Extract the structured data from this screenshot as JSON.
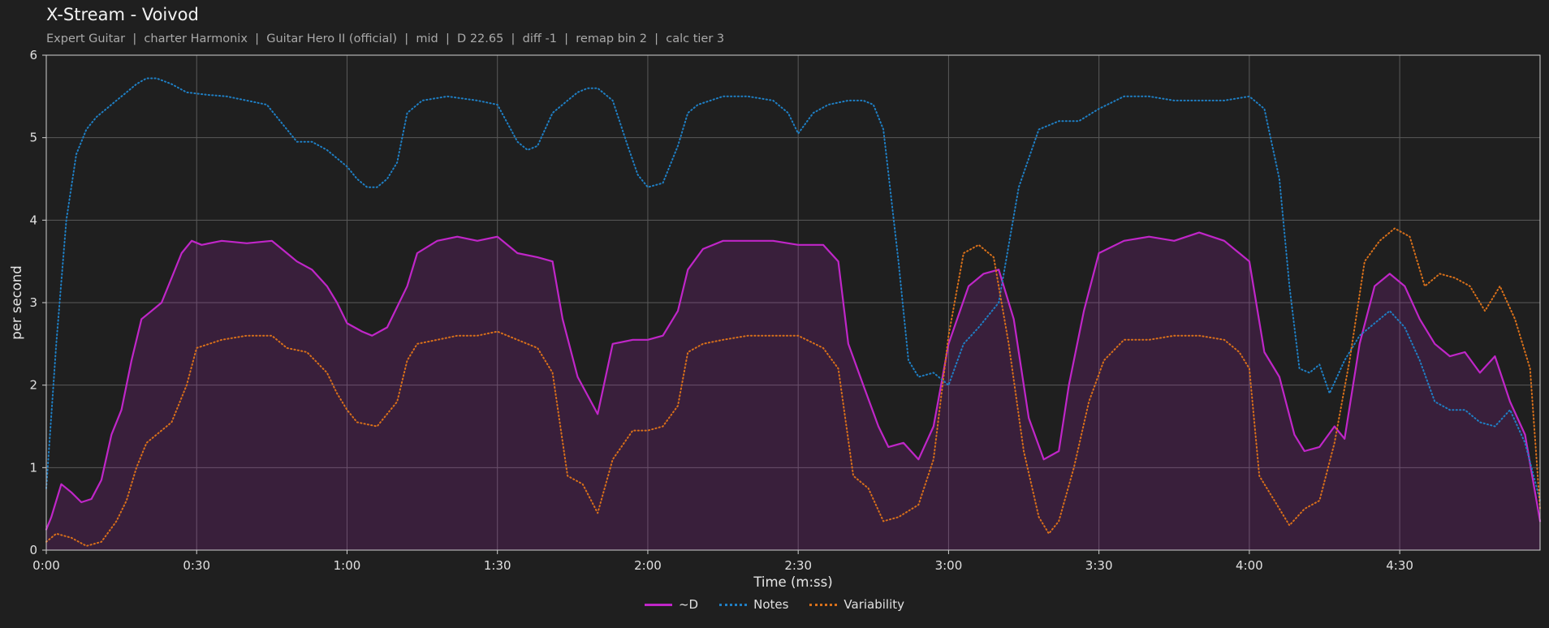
{
  "header": {
    "title": "X-Stream - Voivod",
    "subtitle": "Expert Guitar  |  charter Harmonix  |  Guitar Hero II (official)  |  mid  |  D 22.65  |  diff -1  |  remap bin 2  |  calc tier 3"
  },
  "chart_data": {
    "type": "line",
    "xlabel": "Time (m:ss)",
    "ylabel": "per second",
    "xlim": [
      0,
      298
    ],
    "ylim": [
      0,
      6
    ],
    "x_ticks": [
      0,
      30,
      60,
      90,
      120,
      150,
      180,
      210,
      240,
      270
    ],
    "x_tick_labels": [
      "0:00",
      "0:30",
      "1:00",
      "1:30",
      "2:00",
      "2:30",
      "3:00",
      "3:30",
      "4:00",
      "4:30"
    ],
    "y_ticks": [
      0,
      1,
      2,
      3,
      4,
      5,
      6
    ],
    "y_tick_labels": [
      "0",
      "1",
      "2",
      "3",
      "4",
      "5",
      "6"
    ],
    "grid": true,
    "legend_position": "bottom-center",
    "series": [
      {
        "name": "~D",
        "color": "#c026c8",
        "style": "solid",
        "fill": true,
        "x": [
          0,
          1,
          3,
          5,
          7,
          9,
          11,
          13,
          15,
          17,
          19,
          21,
          23,
          25,
          27,
          29,
          31,
          35,
          40,
          45,
          48,
          50,
          53,
          56,
          58,
          60,
          63,
          65,
          68,
          72,
          74,
          78,
          82,
          86,
          90,
          94,
          98,
          101,
          103,
          106,
          110,
          113,
          117,
          120,
          123,
          126,
          128,
          131,
          135,
          140,
          145,
          150,
          155,
          158,
          160,
          163,
          166,
          168,
          171,
          174,
          177,
          180,
          184,
          187,
          190,
          193,
          196,
          199,
          202,
          204,
          207,
          210,
          215,
          220,
          225,
          230,
          235,
          238,
          240,
          243,
          246,
          249,
          251,
          254,
          257,
          259,
          262,
          265,
          268,
          271,
          274,
          277,
          280,
          283,
          286,
          289,
          292,
          295,
          298
        ],
        "y": [
          0.25,
          0.4,
          0.8,
          0.7,
          0.58,
          0.62,
          0.85,
          1.4,
          1.7,
          2.3,
          2.8,
          2.9,
          3.0,
          3.3,
          3.6,
          3.75,
          3.7,
          3.75,
          3.72,
          3.75,
          3.6,
          3.5,
          3.4,
          3.2,
          3.0,
          2.75,
          2.65,
          2.6,
          2.7,
          3.2,
          3.6,
          3.75,
          3.8,
          3.75,
          3.8,
          3.6,
          3.55,
          3.5,
          2.8,
          2.1,
          1.65,
          2.5,
          2.55,
          2.55,
          2.6,
          2.9,
          3.4,
          3.65,
          3.75,
          3.75,
          3.75,
          3.7,
          3.7,
          3.5,
          2.5,
          2.0,
          1.5,
          1.25,
          1.3,
          1.1,
          1.5,
          2.5,
          3.2,
          3.35,
          3.4,
          2.8,
          1.6,
          1.1,
          1.2,
          2.0,
          2.9,
          3.6,
          3.75,
          3.8,
          3.75,
          3.85,
          3.75,
          3.6,
          3.5,
          2.4,
          2.1,
          1.4,
          1.2,
          1.25,
          1.5,
          1.35,
          2.5,
          3.2,
          3.35,
          3.2,
          2.8,
          2.5,
          2.35,
          2.4,
          2.15,
          2.35,
          1.8,
          1.4,
          0.35
        ]
      },
      {
        "name": "Notes",
        "color": "#1f7fc4",
        "style": "dotted",
        "fill": false,
        "x": [
          0,
          2,
          4,
          6,
          8,
          10,
          12,
          14,
          16,
          18,
          20,
          22,
          25,
          28,
          32,
          36,
          40,
          44,
          48,
          50,
          53,
          56,
          58,
          60,
          62,
          64,
          66,
          68,
          70,
          72,
          75,
          80,
          86,
          90,
          94,
          96,
          98,
          101,
          104,
          106,
          108,
          110,
          113,
          116,
          118,
          120,
          123,
          126,
          128,
          130,
          135,
          140,
          145,
          148,
          150,
          153,
          156,
          160,
          163,
          165,
          167,
          170,
          172,
          174,
          177,
          180,
          183,
          186,
          190,
          194,
          198,
          202,
          206,
          210,
          215,
          220,
          225,
          230,
          235,
          240,
          243,
          246,
          248,
          250,
          252,
          254,
          256,
          259,
          262,
          265,
          268,
          271,
          274,
          277,
          280,
          283,
          286,
          289,
          292,
          295,
          298
        ],
        "y": [
          0.75,
          2.5,
          4.0,
          4.8,
          5.1,
          5.25,
          5.35,
          5.45,
          5.55,
          5.65,
          5.72,
          5.72,
          5.65,
          5.55,
          5.52,
          5.5,
          5.45,
          5.4,
          5.1,
          4.95,
          4.95,
          4.85,
          4.75,
          4.65,
          4.5,
          4.4,
          4.4,
          4.5,
          4.7,
          5.3,
          5.45,
          5.5,
          5.45,
          5.4,
          4.95,
          4.85,
          4.9,
          5.3,
          5.45,
          5.55,
          5.6,
          5.6,
          5.45,
          4.9,
          4.55,
          4.4,
          4.45,
          4.9,
          5.3,
          5.4,
          5.5,
          5.5,
          5.45,
          5.3,
          5.05,
          5.3,
          5.4,
          5.45,
          5.45,
          5.4,
          5.1,
          3.5,
          2.3,
          2.1,
          2.15,
          2.0,
          2.5,
          2.7,
          3.0,
          4.4,
          5.1,
          5.2,
          5.2,
          5.35,
          5.5,
          5.5,
          5.45,
          5.45,
          5.45,
          5.5,
          5.35,
          4.5,
          3.2,
          2.2,
          2.15,
          2.25,
          1.9,
          2.3,
          2.6,
          2.75,
          2.9,
          2.7,
          2.3,
          1.8,
          1.7,
          1.7,
          1.55,
          1.5,
          1.7,
          1.3,
          0.6
        ]
      },
      {
        "name": "Variability",
        "color": "#d9701a",
        "style": "dotted",
        "fill": false,
        "x": [
          0,
          2,
          5,
          8,
          11,
          14,
          16,
          18,
          20,
          22,
          25,
          28,
          30,
          35,
          40,
          45,
          48,
          52,
          56,
          58,
          60,
          62,
          66,
          70,
          72,
          74,
          78,
          82,
          86,
          90,
          94,
          98,
          101,
          104,
          107,
          110,
          113,
          117,
          120,
          123,
          126,
          128,
          131,
          135,
          140,
          145,
          150,
          155,
          158,
          161,
          164,
          167,
          170,
          174,
          177,
          180,
          183,
          186,
          189,
          192,
          195,
          198,
          200,
          202,
          205,
          208,
          211,
          215,
          220,
          225,
          230,
          235,
          238,
          240,
          242,
          245,
          248,
          251,
          254,
          257,
          260,
          263,
          266,
          269,
          272,
          275,
          278,
          281,
          284,
          287,
          290,
          293,
          296,
          298
        ],
        "y": [
          0.1,
          0.2,
          0.15,
          0.05,
          0.1,
          0.35,
          0.6,
          1.0,
          1.3,
          1.4,
          1.55,
          2.0,
          2.45,
          2.55,
          2.6,
          2.6,
          2.45,
          2.4,
          2.15,
          1.9,
          1.7,
          1.55,
          1.5,
          1.8,
          2.3,
          2.5,
          2.55,
          2.6,
          2.6,
          2.65,
          2.55,
          2.45,
          2.15,
          0.9,
          0.8,
          0.45,
          1.1,
          1.45,
          1.45,
          1.5,
          1.75,
          2.4,
          2.5,
          2.55,
          2.6,
          2.6,
          2.6,
          2.45,
          2.2,
          0.9,
          0.75,
          0.35,
          0.4,
          0.55,
          1.1,
          2.6,
          3.6,
          3.7,
          3.55,
          2.5,
          1.2,
          0.4,
          0.2,
          0.35,
          1.0,
          1.8,
          2.3,
          2.55,
          2.55,
          2.6,
          2.6,
          2.55,
          2.4,
          2.2,
          0.9,
          0.6,
          0.3,
          0.5,
          0.6,
          1.3,
          2.3,
          3.5,
          3.75,
          3.9,
          3.8,
          3.2,
          3.35,
          3.3,
          3.2,
          2.9,
          3.2,
          2.8,
          2.2,
          0.5
        ]
      }
    ]
  }
}
